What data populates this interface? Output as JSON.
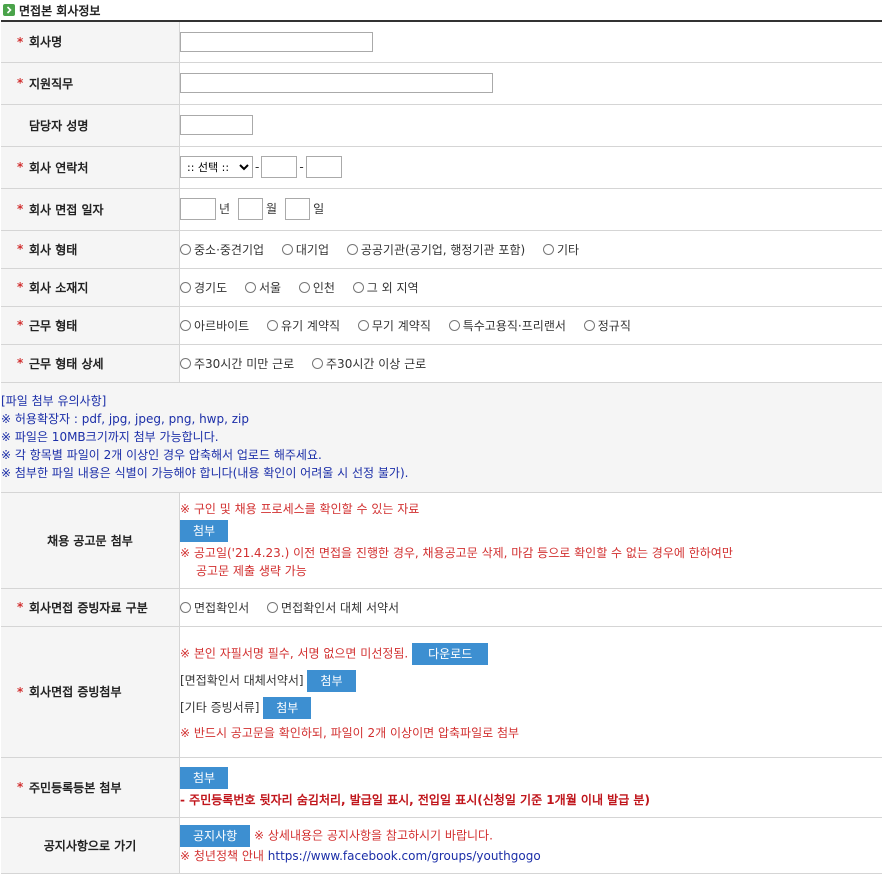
{
  "section": {
    "title": "면접본 회사정보"
  },
  "rows": {
    "company_name": {
      "label": "회사명"
    },
    "job": {
      "label": "지원직무"
    },
    "manager": {
      "label": "담당자 성명"
    },
    "contact": {
      "label": "회사 연락처",
      "select_value": ":: 선택 ::",
      "dash": "-"
    },
    "interview_date": {
      "label": "회사 면접 일자",
      "year": "년",
      "month": "월",
      "day": "일"
    },
    "company_type": {
      "label": "회사 형태",
      "options": [
        "중소·중견기업",
        "대기업",
        "공공기관(공기업, 행정기관 포함)",
        "기타"
      ]
    },
    "location": {
      "label": "회사 소재지",
      "options": [
        "경기도",
        "서울",
        "인천",
        "그 외 지역"
      ]
    },
    "work_type": {
      "label": "근무 형태",
      "options": [
        "아르바이트",
        "유기 계약직",
        "무기 계약직",
        "특수고용직·프리랜서",
        "정규직"
      ]
    },
    "work_detail": {
      "label": "근무 형태 상세",
      "options": [
        "주30시간 미만 근로",
        "주30시간 이상 근로"
      ]
    },
    "notice": {
      "lines": [
        "[파일 첨부 유의사항]",
        "※ 허용확장자 : pdf, jpg, jpeg, png, hwp, zip",
        "※ 파일은 10MB크기까지 첨부 가능합니다.",
        "※ 각 항목별 파일이 2개 이상인 경우 압축해서 업로드 해주세요.",
        "※ 첨부한 파일 내용은 식별이 가능해야 합니다(내용 확인이 어려울 시 선정 불가)."
      ]
    },
    "recruit_notice": {
      "label": "채용 공고문 첨부",
      "note1": "※ 구인 및 채용 프로세스를 확인할 수 있는 자료",
      "button": "첨부",
      "note2": "※ 공고일('21.4.23.) 이전 면접을 진행한 경우, 채용공고문 삭제, 마감 등으로 확인할 수 없는 경우에 한하여만",
      "note3": "공고문 제출 생략 가능"
    },
    "proof_type": {
      "label": "회사면접 증빙자료 구분",
      "options": [
        "면접확인서",
        "면접확인서 대체 서약서"
      ]
    },
    "proof_attach": {
      "label": "회사면접 증빙첨부",
      "note1": "※ 본인 자필서명 필수, 서명 없으면 미선정됨.",
      "download": "다운로드",
      "alt_label": "[면접확인서 대체서약서]",
      "alt_button": "첨부",
      "etc_label": "[기타 증빙서류]",
      "etc_button": "첨부",
      "note2": "※ 반드시 공고문을 확인하되, 파일이 2개 이상이면 압축파일로 첨부"
    },
    "resident": {
      "label": "주민등록등본 첨부",
      "button": "첨부",
      "note": "- 주민등록번호 뒷자리 숨김처리, 발급일 표시, 전입일 표시(신청일 기준 1개월 이내 발급 분)"
    },
    "goto_notice": {
      "label": "공지사항으로 가기",
      "button": "공지사항",
      "note": "※ 상세내용은 공지사항을 참고하시기 바랍니다.",
      "youth_prefix": "※ 청년정책 안내",
      "youth_link": "https://www.facebook.com/groups/youthgogo"
    }
  },
  "required_mark": "*",
  "colors": {
    "button": "#3d8fd1",
    "required": "#d23030",
    "notice_text": "#1b2ea8",
    "label_bg": "#f5f5f5"
  }
}
